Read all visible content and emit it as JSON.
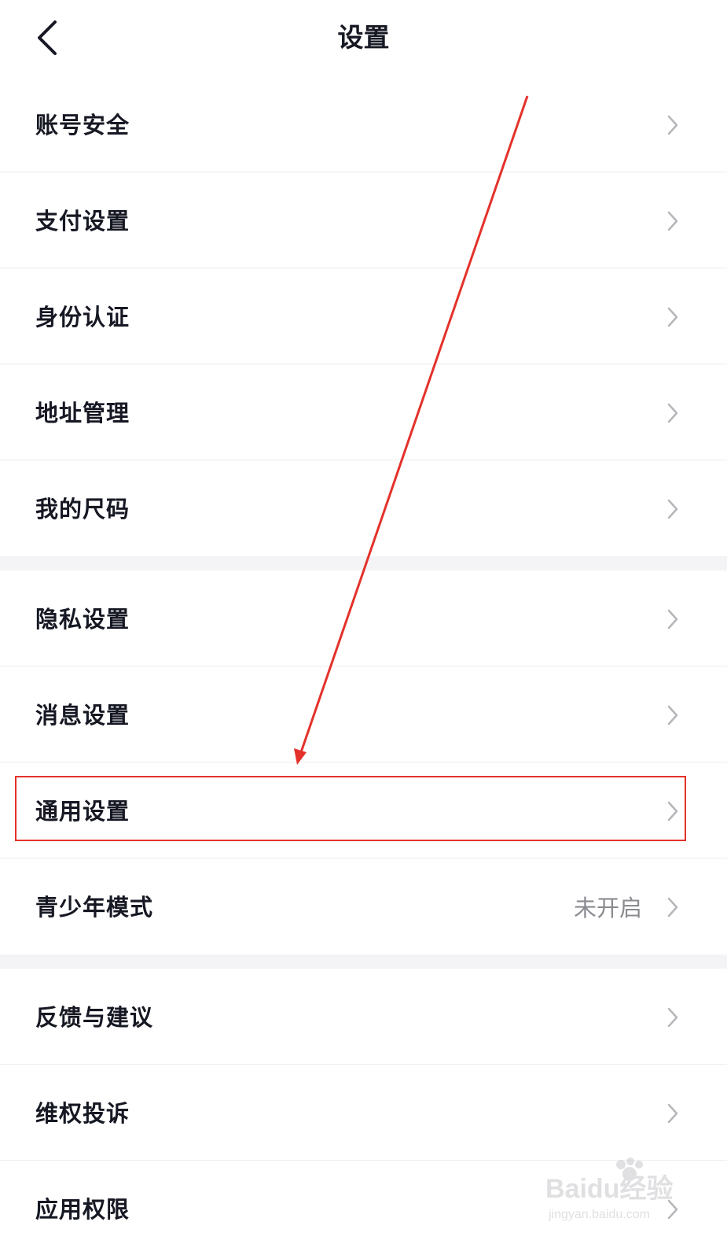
{
  "header": {
    "title": "设置"
  },
  "groups": [
    {
      "items": [
        {
          "label": "账号安全",
          "value": ""
        },
        {
          "label": "支付设置",
          "value": ""
        },
        {
          "label": "身份认证",
          "value": ""
        },
        {
          "label": "地址管理",
          "value": ""
        },
        {
          "label": "我的尺码",
          "value": ""
        }
      ]
    },
    {
      "items": [
        {
          "label": "隐私设置",
          "value": ""
        },
        {
          "label": "消息设置",
          "value": ""
        },
        {
          "label": "通用设置",
          "value": ""
        },
        {
          "label": "青少年模式",
          "value": "未开启"
        }
      ]
    },
    {
      "items": [
        {
          "label": "反馈与建议",
          "value": ""
        },
        {
          "label": "维权投诉",
          "value": ""
        },
        {
          "label": "应用权限",
          "value": ""
        }
      ]
    }
  ],
  "annotation": {
    "highlighted_item": "通用设置",
    "color": "#e4322b"
  },
  "watermark": {
    "text": "Baidu经验",
    "url": "jingyan.baidu.com"
  },
  "colors": {
    "text": "#161823",
    "secondary": "#8a8b91",
    "divider": "#ededf0",
    "group_gap": "#f4f4f6"
  }
}
